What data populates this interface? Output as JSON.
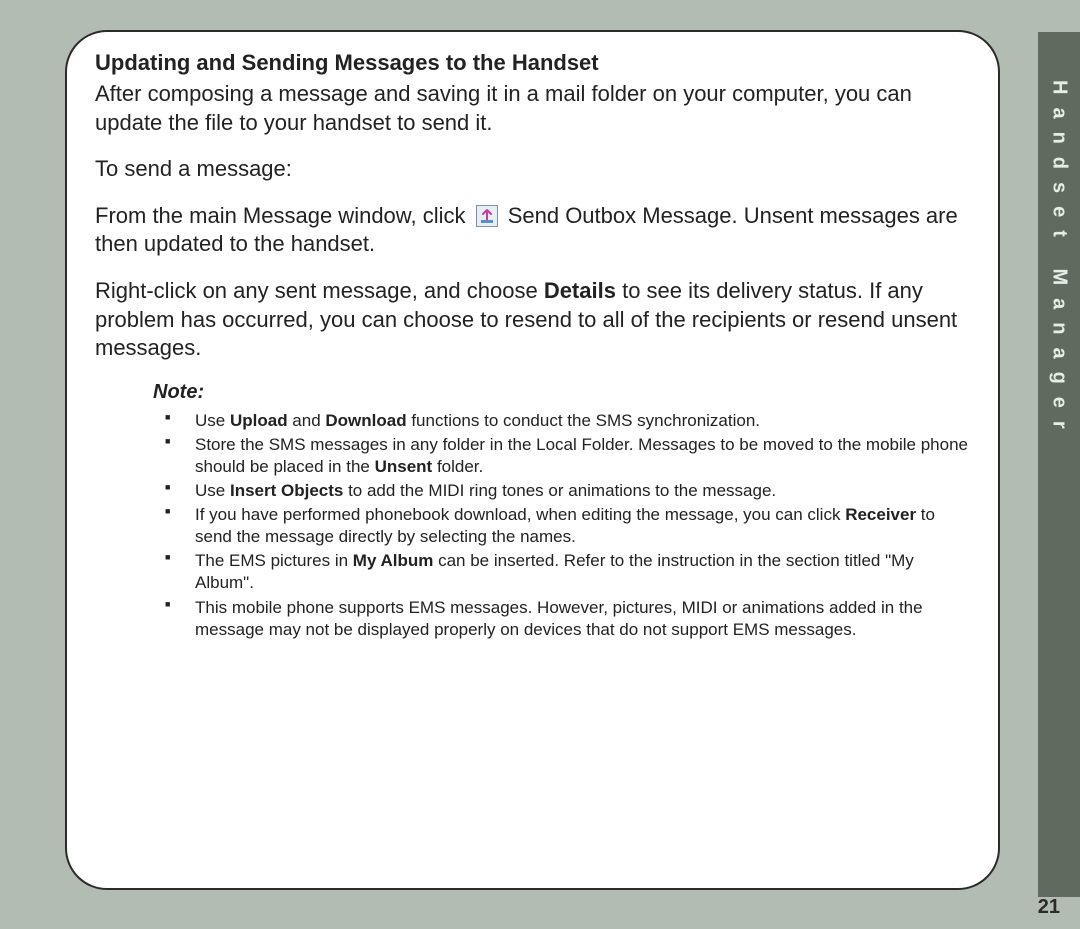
{
  "sideTab": "Handset Manager",
  "heading": "Updating and Sending Messages to the Handset",
  "p1": "After composing a message and saving it in a mail folder on your computer, you can update the file to your handset to send it.",
  "p2": "To send a message:",
  "p3a": "From the main Message window, click ",
  "p3b": " Send Outbox Message.  Unsent messages are then updated to the handset.",
  "p4a": "Right-click on any sent message, and choose ",
  "p4bold": "Details",
  "p4b": " to see its delivery status. If any problem has occurred, you can choose to resend to all of the recipients or resend unsent messages.",
  "noteLabel": "Note:",
  "bullets": {
    "b1a": "Use ",
    "b1u": "Upload",
    "b1m": " and ",
    "b1d": "Download",
    "b1b": " functions to conduct the SMS synchronization.",
    "b2a": "Store the SMS messages in any folder in the Local Folder. Messages to be moved to the mobile phone should be placed in the ",
    "b2bold": "Unsent",
    "b2b": " folder.",
    "b3a": "Use ",
    "b3bold": "Insert Objects",
    "b3b": " to add the MIDI ring tones or animations to the message.",
    "b4a": "If you have performed phonebook download, when editing the message, you can click ",
    "b4bold": "Receiver",
    "b4b": " to send the message directly by selecting the names.",
    "b5a": "The EMS pictures in ",
    "b5bold": "My Album",
    "b5b": " can be inserted. Refer to the instruction in the section titled \"My Album\".",
    "b6": "This mobile phone supports EMS messages. However, pictures, MIDI or animations added in the message may not be displayed properly on devices that do not support EMS messages."
  },
  "pageNumber": "21"
}
